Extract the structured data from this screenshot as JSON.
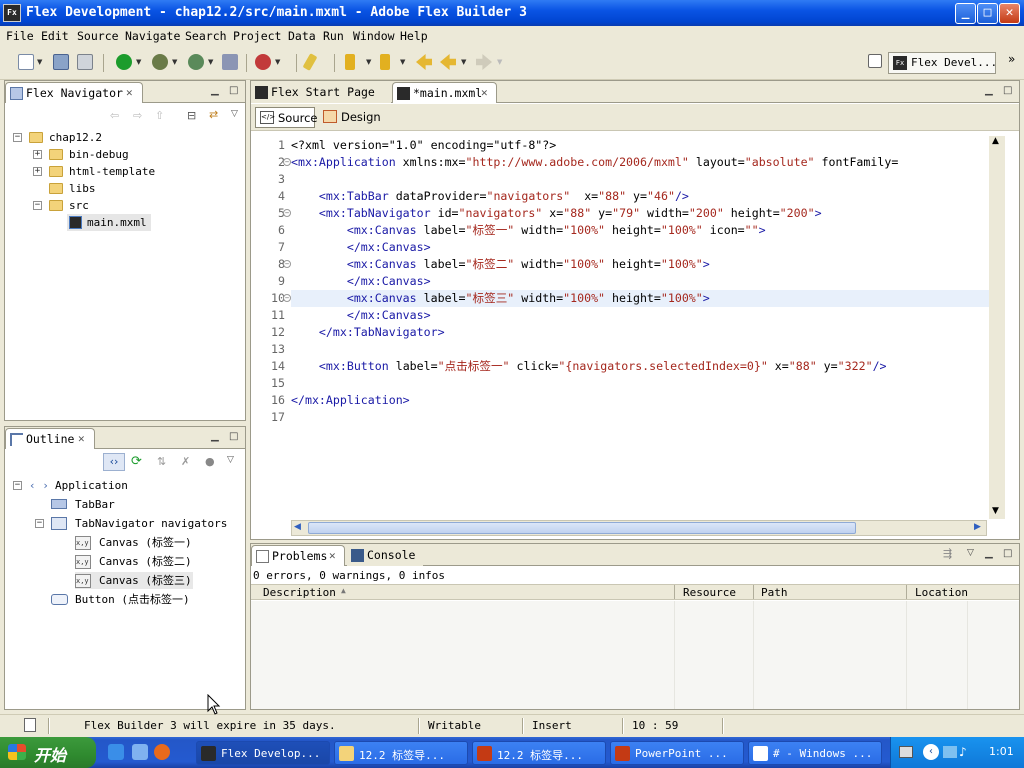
{
  "window": {
    "title": "Flex Development - chap12.2/src/main.mxml - Adobe Flex Builder 3",
    "app_icon": "Fx",
    "min": "_",
    "max": "□",
    "close": "✕"
  },
  "menu": [
    "File",
    "Edit",
    "Source",
    "Navigate",
    "Search",
    "Project",
    "Data",
    "Run",
    "Window",
    "Help"
  ],
  "perspective": {
    "label": "Flex Devel...",
    "more": "»"
  },
  "navigator": {
    "tab": "Flex Navigator",
    "close": "✕",
    "items": [
      {
        "label": "chap12.2"
      },
      {
        "label": "bin-debug"
      },
      {
        "label": "html-template"
      },
      {
        "label": "libs"
      },
      {
        "label": "src"
      },
      {
        "label": "main.mxml"
      }
    ]
  },
  "outline": {
    "tab": "Outline",
    "close": "✕",
    "items": [
      {
        "label": "Application"
      },
      {
        "label": "TabBar"
      },
      {
        "label": "TabNavigator navigators"
      },
      {
        "label": "Canvas (标签一)"
      },
      {
        "label": "Canvas (标签二)"
      },
      {
        "label": "Canvas (标签三)"
      },
      {
        "label": "Button (点击标签一)"
      }
    ]
  },
  "editor": {
    "tabs": [
      {
        "label": "Flex Start Page"
      },
      {
        "label": "*main.mxml",
        "close": "✕"
      }
    ],
    "modes": {
      "source": "Source",
      "design": "Design"
    },
    "line_numbers": [
      "1",
      "2",
      "3",
      "4",
      "5",
      "6",
      "7",
      "8",
      "9",
      "10",
      "11",
      "12",
      "13",
      "14",
      "15",
      "16",
      "17"
    ],
    "lines": [
      [
        [
          "pi",
          "<?xml version=\"1.0\" encoding=\"utf-8\"?>"
        ]
      ],
      [
        [
          "tg",
          "<mx:Application"
        ],
        [
          "at",
          " xmlns:mx="
        ],
        [
          "vl",
          "\"http://www.adobe.com/2006/mxml\""
        ],
        [
          "at",
          " layout="
        ],
        [
          "vl",
          "\"absolute\""
        ],
        [
          "at",
          " fontFamily="
        ]
      ],
      [],
      [
        [
          "at",
          "    "
        ],
        [
          "tg",
          "<mx:TabBar"
        ],
        [
          "at",
          " dataProvider="
        ],
        [
          "vl",
          "\"navigators\""
        ],
        [
          "at",
          "  x="
        ],
        [
          "vl",
          "\"88\""
        ],
        [
          "at",
          " y="
        ],
        [
          "vl",
          "\"46\""
        ],
        [
          "tg",
          "/>"
        ]
      ],
      [
        [
          "at",
          "    "
        ],
        [
          "tg",
          "<mx:TabNavigator"
        ],
        [
          "at",
          " id="
        ],
        [
          "vl",
          "\"navigators\""
        ],
        [
          "at",
          " x="
        ],
        [
          "vl",
          "\"88\""
        ],
        [
          "at",
          " y="
        ],
        [
          "vl",
          "\"79\""
        ],
        [
          "at",
          " width="
        ],
        [
          "vl",
          "\"200\""
        ],
        [
          "at",
          " height="
        ],
        [
          "vl",
          "\"200\""
        ],
        [
          "tg",
          ">"
        ]
      ],
      [
        [
          "at",
          "        "
        ],
        [
          "tg",
          "<mx:Canvas"
        ],
        [
          "at",
          " label="
        ],
        [
          "vl",
          "\"标签一\""
        ],
        [
          "at",
          " width="
        ],
        [
          "vl",
          "\"100%\""
        ],
        [
          "at",
          " height="
        ],
        [
          "vl",
          "\"100%\""
        ],
        [
          "at",
          " icon="
        ],
        [
          "vl",
          "\"\""
        ],
        [
          "tg",
          ">"
        ]
      ],
      [
        [
          "at",
          "        "
        ],
        [
          "tg",
          "</mx:Canvas>"
        ]
      ],
      [
        [
          "at",
          "        "
        ],
        [
          "tg",
          "<mx:Canvas"
        ],
        [
          "at",
          " label="
        ],
        [
          "vl",
          "\"标签二\""
        ],
        [
          "at",
          " width="
        ],
        [
          "vl",
          "\"100%\""
        ],
        [
          "at",
          " height="
        ],
        [
          "vl",
          "\"100%\""
        ],
        [
          "tg",
          ">"
        ]
      ],
      [
        [
          "at",
          "        "
        ],
        [
          "tg",
          "</mx:Canvas>"
        ]
      ],
      [
        [
          "at",
          "        "
        ],
        [
          "tg",
          "<mx:Canvas"
        ],
        [
          "at",
          " label="
        ],
        [
          "vl",
          "\"标签三\""
        ],
        [
          "at",
          " width="
        ],
        [
          "vl",
          "\"100%\""
        ],
        [
          "at",
          " height="
        ],
        [
          "vl",
          "\"100%\""
        ],
        [
          "tg",
          ">"
        ]
      ],
      [
        [
          "at",
          "        "
        ],
        [
          "tg",
          "</mx:Canvas>"
        ]
      ],
      [
        [
          "at",
          "    "
        ],
        [
          "tg",
          "</mx:TabNavigator>"
        ]
      ],
      [],
      [
        [
          "at",
          "    "
        ],
        [
          "tg",
          "<mx:Button"
        ],
        [
          "at",
          " label="
        ],
        [
          "vl",
          "\"点击标签一\""
        ],
        [
          "at",
          " click="
        ],
        [
          "vl",
          "\"{navigators.selectedIndex=0}\""
        ],
        [
          "at",
          " x="
        ],
        [
          "vl",
          "\"88\""
        ],
        [
          "at",
          " y="
        ],
        [
          "vl",
          "\"322\""
        ],
        [
          "tg",
          "/>"
        ]
      ],
      [],
      [
        [
          "tg",
          "</mx:Application>"
        ]
      ],
      []
    ]
  },
  "problems": {
    "tabs": [
      {
        "label": "Problems",
        "close": "✕"
      },
      {
        "label": "Console"
      }
    ],
    "summary": "0 errors, 0 warnings, 0 infos",
    "columns": [
      "Description",
      "Resource",
      "Path",
      "Location"
    ]
  },
  "status": {
    "message": "Flex Builder 3 will expire in 35 days.",
    "mode": "Writable",
    "insert": "Insert",
    "position": "10 : 59"
  },
  "taskbar": {
    "start": "开始",
    "tasks": [
      "Flex Develop...",
      "12.2 标签导...",
      "12.2 标签导...",
      "PowerPoint ...",
      "# - Windows ..."
    ],
    "clock": "1:01"
  },
  "colors": {
    "tag": "#1a1aa6",
    "value": "#a5281e",
    "taskbar": "#245ad0",
    "title": "#0a54e4"
  }
}
